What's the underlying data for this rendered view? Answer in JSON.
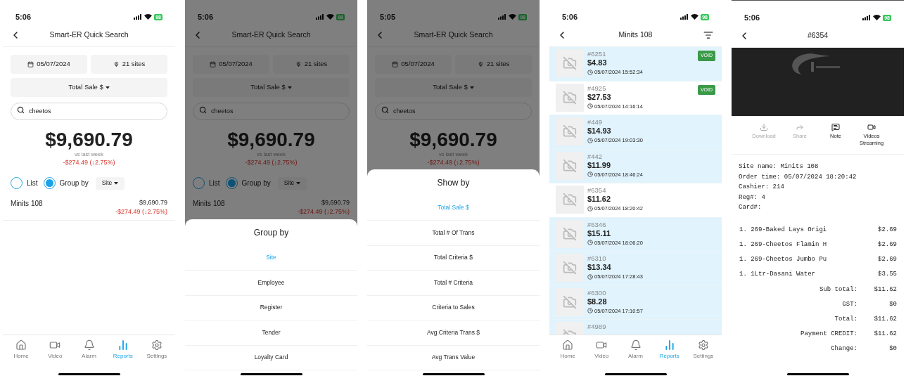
{
  "screens": [
    {
      "kind": "search",
      "status": {
        "time": "5:06",
        "battery": "98"
      },
      "title": "Smart-ER Quick Search",
      "date": "05/07/2024",
      "sites": "21 sites",
      "metric": "Total Sale $",
      "search": {
        "value": "cheetos"
      },
      "total": "$9,690.79",
      "compare_label": "vs last week",
      "change": "-$274.49 (↓2.75%)",
      "view_options": [
        {
          "label": "List",
          "selected": false
        },
        {
          "label": "Group by",
          "selected": true
        }
      ],
      "group_value": "Site",
      "rows": [
        {
          "name": "Minits 108",
          "value": "$9,690.79",
          "change": "-$274.49 (↓2.75%)"
        }
      ],
      "tab_bar": [
        {
          "label": "Home",
          "selected": false
        },
        {
          "label": "Video",
          "selected": false
        },
        {
          "label": "Alarm",
          "selected": false
        },
        {
          "label": "Reports",
          "selected": true
        },
        {
          "label": "Settings",
          "selected": false
        }
      ]
    },
    {
      "kind": "search",
      "status": {
        "time": "5:06",
        "battery": "98"
      },
      "title": "Smart-ER Quick Search",
      "date": "05/07/2024",
      "sites": "21 sites",
      "metric": "Total Sale $",
      "search": {
        "value": "cheetos"
      },
      "total": "$9,690.79",
      "compare_label": "vs last week",
      "change": "-$274.49 (↓2.75%)",
      "view_options": [
        {
          "label": "List",
          "selected": false
        },
        {
          "label": "Group by",
          "selected": true
        }
      ],
      "group_value": "Site",
      "rows": [
        {
          "name": "Minits 108",
          "value": "$9,690.79",
          "change": "-$274.49 (↓2.75%)"
        }
      ],
      "sheet": {
        "title": "Group by",
        "options": [
          {
            "label": "Site",
            "selected": true
          },
          {
            "label": "Employee",
            "selected": false
          },
          {
            "label": "Register",
            "selected": false
          },
          {
            "label": "Tender",
            "selected": false
          },
          {
            "label": "Loyalty Card",
            "selected": false
          }
        ]
      }
    },
    {
      "kind": "search",
      "status": {
        "time": "5:05",
        "battery": "98"
      },
      "title": "Smart-ER Quick Search",
      "date": "05/07/2024",
      "sites": "21 sites",
      "metric": "Total Sale $",
      "search": {
        "value": "cheetos"
      },
      "total": "$9,690.79",
      "compare_label": "vs last week",
      "change": "-$274.49 (↓2.75%)",
      "sheet": {
        "title": "Show by",
        "options": [
          {
            "label": "Total Sale $",
            "selected": true
          },
          {
            "label": "Total # Of Trans",
            "selected": false
          },
          {
            "label": "Total Criteria $",
            "selected": false
          },
          {
            "label": "Total # Criteria",
            "selected": false
          },
          {
            "label": "Criteria to Sales",
            "selected": false
          },
          {
            "label": "Avg Criteria Trans $",
            "selected": false
          },
          {
            "label": "Avg Trans Value",
            "selected": false
          }
        ]
      }
    },
    {
      "kind": "transactions",
      "status": {
        "time": "5:06",
        "battery": "98"
      },
      "title": "Minits 108",
      "rows": [
        {
          "number": "#6251",
          "amount": "$4.83",
          "time": "05/07/2024 15:52:34",
          "badge": "VOID",
          "highlighted": true
        },
        {
          "number": "#4925",
          "amount": "$27.53",
          "time": "05/07/2024 14:16:14",
          "badge": "VOID",
          "highlighted": false
        },
        {
          "number": "#449",
          "amount": "$14.93",
          "time": "05/07/2024 19:03:30",
          "highlighted": true
        },
        {
          "number": "#442",
          "amount": "$11.99",
          "time": "05/07/2024 18:46:24",
          "highlighted": true
        },
        {
          "number": "#6354",
          "amount": "$11.62",
          "time": "05/07/2024 18:20:42",
          "highlighted": false
        },
        {
          "number": "#6346",
          "amount": "$15.11",
          "time": "05/07/2024 18:06:20",
          "highlighted": true
        },
        {
          "number": "#6310",
          "amount": "$13.34",
          "time": "05/07/2024 17:28:43",
          "highlighted": true
        },
        {
          "number": "#6300",
          "amount": "$8.28",
          "time": "05/07/2024 17:10:57",
          "highlighted": true
        },
        {
          "number": "#4989",
          "highlighted": true
        }
      ],
      "tab_bar": [
        {
          "label": "Home",
          "selected": false
        },
        {
          "label": "Video",
          "selected": false
        },
        {
          "label": "Alarm",
          "selected": false
        },
        {
          "label": "Reports",
          "selected": true
        },
        {
          "label": "Settings",
          "selected": false
        }
      ]
    },
    {
      "kind": "receipt",
      "status": {
        "time": "5:06",
        "battery": "98"
      },
      "title": "#6354",
      "video": {
        "kind": "picture"
      },
      "actions": [
        {
          "label": "Download",
          "disabled": true
        },
        {
          "label": "Share",
          "disabled": true
        },
        {
          "label": "Note",
          "disabled": false
        },
        {
          "label": "Videos Streaming",
          "disabled": false
        }
      ],
      "info": [
        "Site name: Minits 108",
        "Order time: 05/07/2024 18:20:42",
        "Cashier: 214",
        "Reg#: 4",
        "Card#:"
      ],
      "items": [
        {
          "text": "1. 269-Baked Lays Origi",
          "price": "$2.69"
        },
        {
          "text": "1. 269-Cheetos Flamin H",
          "price": "$2.69"
        },
        {
          "text": "1. 269-Cheetos Jumbo Pu",
          "price": "$2.69"
        },
        {
          "text": "1. 1Ltr-Dasani Water",
          "price": "$3.55"
        }
      ],
      "totals": [
        {
          "label": "Sub total:",
          "value": "$11.62"
        },
        {
          "label": "GST:",
          "value": "$0"
        },
        {
          "label": "Total:",
          "value": "$11.62"
        },
        {
          "label": "Payment CREDIT:",
          "value": "$11.62"
        },
        {
          "label": "Change:",
          "value": "$0"
        }
      ]
    }
  ]
}
